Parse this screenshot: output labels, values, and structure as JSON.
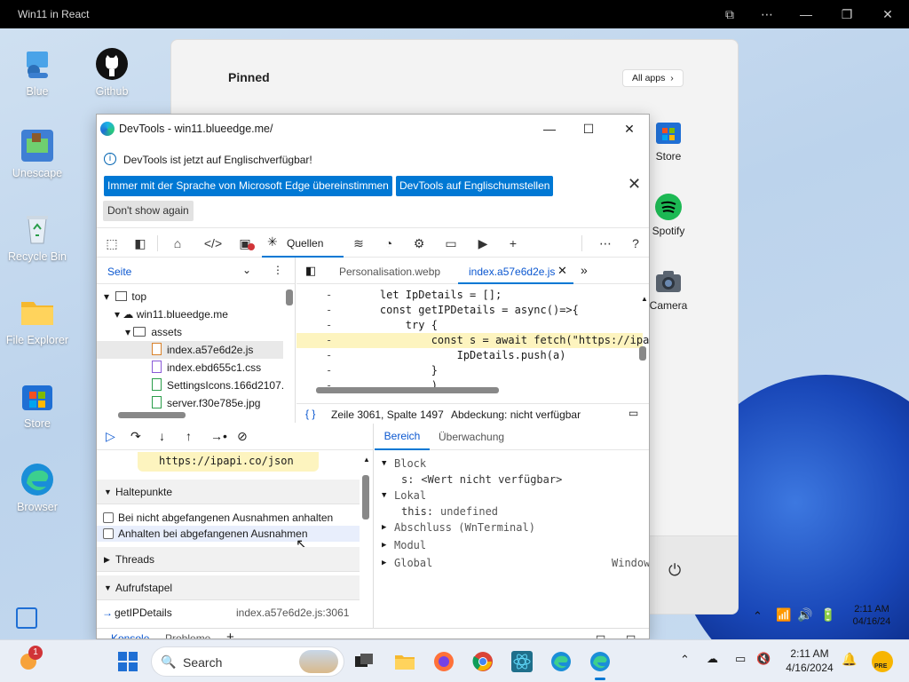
{
  "window": {
    "title": "Win11 in React"
  },
  "desktop": {
    "icons": [
      {
        "label": "Blue",
        "icon": "user-icon"
      },
      {
        "label": "Github",
        "icon": "github-icon"
      },
      {
        "label": "Unescape",
        "icon": "game-icon"
      },
      {
        "label": "Recycle Bin",
        "icon": "recycle-bin-icon"
      },
      {
        "label": "File Explorer",
        "icon": "folder-icon"
      },
      {
        "label": "Store",
        "icon": "store-icon"
      },
      {
        "label": "Browser",
        "icon": "edge-icon"
      }
    ]
  },
  "start_menu": {
    "pinned_label": "Pinned",
    "all_apps_label": "All apps",
    "apps": [
      {
        "label": "Store",
        "icon": "store-icon"
      },
      {
        "label": "Spotify",
        "icon": "spotify-icon"
      },
      {
        "label": "Camera",
        "icon": "camera-icon"
      }
    ]
  },
  "devtools": {
    "title": "DevTools - win11.blueedge.me/",
    "info_text": "DevTools ist jetzt auf Englischverfügbar!",
    "btn_match": "Immer mit der Sprache von Microsoft Edge übereinstimmen",
    "btn_english": "DevTools auf Englischumstellen",
    "btn_dont_show": "Don't show again",
    "active_tool": "Quellen",
    "navigator": {
      "header": "Seite",
      "tree": [
        {
          "label": "top",
          "kind": "frame"
        },
        {
          "label": "win11.blueedge.me",
          "kind": "domain"
        },
        {
          "label": "assets",
          "kind": "folder"
        },
        {
          "label": "index.a57e6d2e.js",
          "kind": "js",
          "selected": true
        },
        {
          "label": "index.ebd655c1.css",
          "kind": "css"
        },
        {
          "label": "SettingsIcons.166d2107.",
          "kind": "file"
        },
        {
          "label": "server.f30e785e.jpg",
          "kind": "img"
        }
      ]
    },
    "editor": {
      "tabs": [
        "Personalisation.webp",
        "index.a57e6d2e.js"
      ],
      "active_tab": "index.a57e6d2e.js",
      "lines": [
        {
          "gutter": "-",
          "code": "    let IpDetails = [];"
        },
        {
          "gutter": "-",
          "code": "    const getIPDetails = async()=>{"
        },
        {
          "gutter": "-",
          "code": "        try {"
        },
        {
          "gutter": "-",
          "code": "            const s = await fetch(\"https://ipapi",
          "highlight": true
        },
        {
          "gutter": "-",
          "code": "                IpDetails.push(a)"
        },
        {
          "gutter": "-",
          "code": "            }"
        },
        {
          "gutter": "-",
          "code": "            )"
        }
      ],
      "status_position": "Zeile 3061, Spalte 1497",
      "status_coverage": "Abdeckung: nicht verfügbar"
    },
    "debugger": {
      "tooltip_text": "https://ipapi.co/json",
      "breakpoints_label": "Haltepunkte",
      "chk_uncaught": "Bei nicht abgefangenen Ausnahmen anhalten",
      "chk_caught": "Anhalten bei abgefangenen Ausnahmen",
      "threads_label": "Threads",
      "callstack_label": "Aufrufstapel",
      "callstack": [
        {
          "fn": "getIPDetails",
          "loc": "index.a57e6d2e.js:3061"
        }
      ]
    },
    "scope": {
      "tabs": [
        "Bereich",
        "Überwachung"
      ],
      "active_tab": "Bereich",
      "rows": [
        {
          "kind": "section",
          "label": "Block",
          "expanded": true
        },
        {
          "kind": "var",
          "name": "s:",
          "value": "<Wert nicht verfügbar>"
        },
        {
          "kind": "section",
          "label": "Lokal",
          "expanded": true
        },
        {
          "kind": "var",
          "name": "this:",
          "value": "undefined"
        },
        {
          "kind": "section",
          "label": "Abschluss (WnTerminal)",
          "expanded": false
        },
        {
          "kind": "section",
          "label": "Modul",
          "expanded": false
        },
        {
          "kind": "section",
          "label": "Global",
          "expanded": false,
          "right": "Window"
        }
      ]
    },
    "drawer_tabs": [
      "Konsole",
      "Probleme"
    ]
  },
  "tray_strip": {
    "time": "2:11 AM",
    "date": "04/16/24"
  },
  "taskbar": {
    "search_placeholder": "Search",
    "time": "2:11 AM",
    "date": "4/16/2024",
    "notification_count": "1",
    "pre_badge": "PRE"
  },
  "colors": {
    "accent": "#0078d4",
    "highlight_line": "#fdf4bf",
    "taskbar": "#e9eef6"
  }
}
